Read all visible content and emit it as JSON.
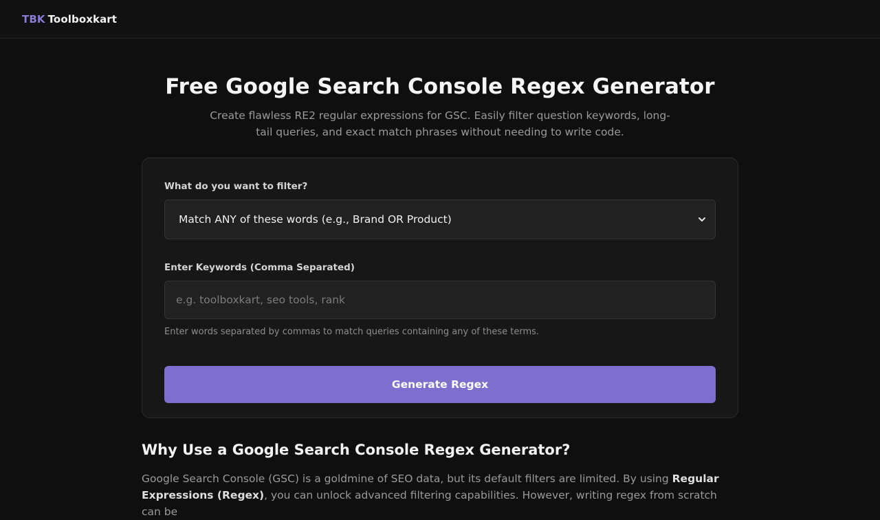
{
  "header": {
    "brand_short": "TBK",
    "brand_name": "Toolboxkart",
    "accent": "#8b7bd6"
  },
  "hero": {
    "title": "Free Google Search Console Regex Generator",
    "subtitle": "Create flawless RE2 regular expressions for GSC. Easily filter question keywords, long-tail queries, and exact match phrases without needing to write code."
  },
  "form": {
    "filter_label": "What do you want to filter?",
    "filter_selected": "Match ANY of these words (e.g., Brand OR Product)",
    "keywords_label": "Enter Keywords (Comma Separated)",
    "keywords_value": "",
    "keywords_placeholder": "e.g. toolboxkart, seo tools, rank",
    "keywords_hint": "Enter words separated by commas to match queries containing any of these terms.",
    "generate_label": "Generate Regex",
    "button_color": "#7e6fcf"
  },
  "article": {
    "heading": "Why Use a Google Search Console Regex Generator?",
    "para_start": "Google Search Console (GSC) is a goldmine of SEO data, but its default filters are limited. By using ",
    "para_bold": "Regular Expressions (Regex)",
    "para_end": ", you can unlock advanced filtering capabilities. However, writing regex from scratch can be"
  },
  "icons": {
    "select_arrow": "chevron-down-icon"
  }
}
